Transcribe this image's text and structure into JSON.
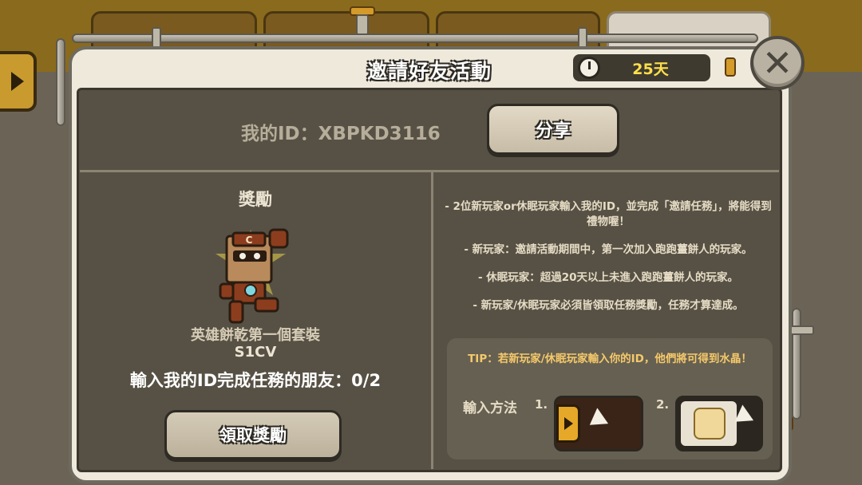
{
  "header": {
    "title": "邀請好友活動",
    "timer": "25天"
  },
  "id_section": {
    "my_id": "我的ID：XBPKD3116",
    "share_label": "分享"
  },
  "reward": {
    "title": "獎勵",
    "name": "英雄餅乾第一個套裝",
    "code": "S1CV",
    "progress_text": "輸入我的ID完成任務的朋友：0/2",
    "progress_current": 0,
    "progress_total": 2,
    "claim_label": "領取獎勵"
  },
  "rules": [
    "- 2位新玩家or休眠玩家輸入我的ID，並完成「邀請任務」，將能得到禮物喔！",
    "- 新玩家：邀請活動期間中，第一次加入跑跑薑餅人的玩家。",
    "- 休眠玩家：超過20天以上未進入跑跑薑餅人的玩家。",
    "- 新玩家/休眠玩家必須皆領取任務獎勵，任務才算達成。"
  ],
  "tip": {
    "text": "TIP：若新玩家/休眠玩家輸入你的ID，他們將可得到水晶！",
    "method_label": "輸入方法",
    "steps": [
      {
        "num": "1.",
        "icon": "side-menu-tab-icon"
      },
      {
        "num": "2.",
        "icon": "friends-icon"
      }
    ]
  },
  "colors": {
    "timer_text": "#ffe04a",
    "tip_text": "#f5c96a",
    "panel_dark": "#575145"
  }
}
